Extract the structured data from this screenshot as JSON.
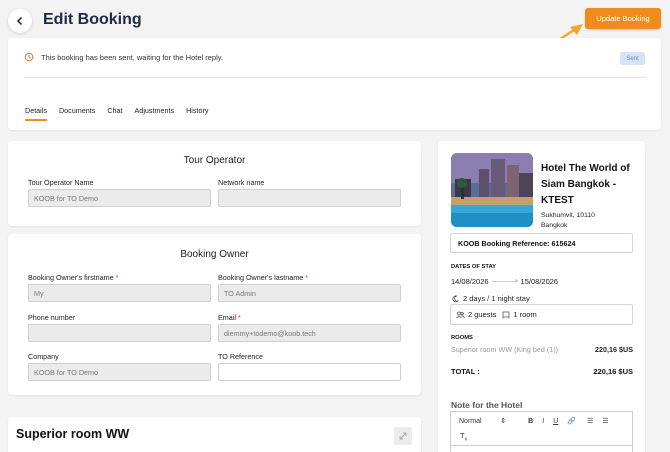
{
  "header": {
    "title": "Edit Booking",
    "back_icon": "chevron-left-icon",
    "update_label": "Update Booking",
    "accent_color": "#f08c1e"
  },
  "notice": {
    "icon": "history-icon",
    "text": "This booking has been sent, waiting for the Hotel reply.",
    "badge": "Sent"
  },
  "tabs": [
    {
      "label": "Details",
      "active": true
    },
    {
      "label": "Documents",
      "active": false
    },
    {
      "label": "Chat",
      "active": false
    },
    {
      "label": "Adjustments",
      "active": false
    },
    {
      "label": "History",
      "active": false
    }
  ],
  "tour_operator": {
    "title": "Tour Operator",
    "name_label": "Tour Operator Name",
    "name_value": "KOOB for TO Demo",
    "network_label": "Network name",
    "network_value": ""
  },
  "booking_owner": {
    "title": "Booking Owner",
    "firstname_label": "Booking Owner's firstname",
    "firstname_value": "My",
    "lastname_label": "Booking Owner's lastname",
    "lastname_value": "TO Admin",
    "phone_label": "Phone number",
    "phone_value": "",
    "email_label": "Email",
    "email_value": "diemmy+todemo@koob.tech",
    "company_label": "Company",
    "company_value": "KOOB for TO Demo",
    "reference_label": "TO Reference",
    "reference_value": "",
    "required_mark": "*"
  },
  "room": {
    "title": "Superior room WW",
    "edit_icon": "expand-icon"
  },
  "hotel": {
    "name": "Hotel The World of Siam Bangkok - KTEST",
    "address": "Sukhumvit, 10110 Bangkok",
    "reference": "KOOB Booking Reference: 615624",
    "dates_label": "DATES OF STAY",
    "date_from": "14/08/2026",
    "date_to": "15/08/2026",
    "stay": "2 days / 1 night stay",
    "guests": "2 guests",
    "rooms_count": "1 room",
    "rooms_label": "ROOMS",
    "room_line_name": "Superior room WW (King bed (1))",
    "room_line_price": "220,16 $US",
    "total_label": "TOTAL :",
    "total_price": "220,16 $US",
    "note_label": "Note for the Hotel",
    "editor_format": "Normal"
  }
}
